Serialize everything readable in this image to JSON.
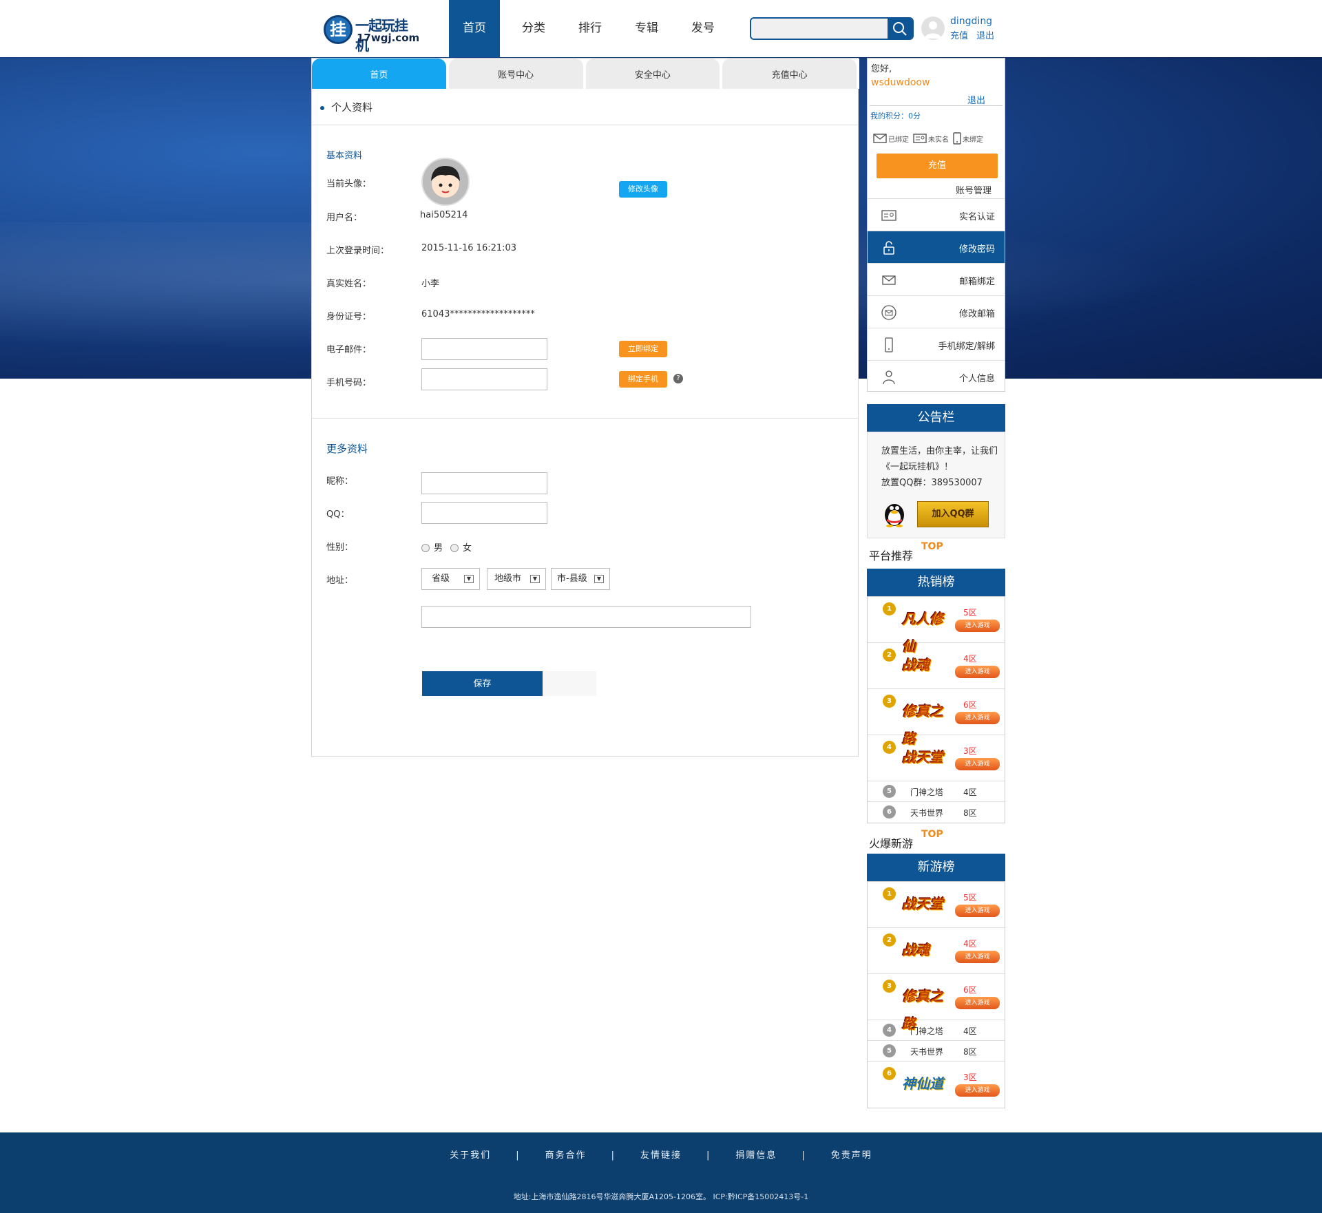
{
  "header": {
    "logo_text": "一起玩挂机",
    "logo_url": "17wgj.com",
    "nav": [
      "首页",
      "分类",
      "排行",
      "专辑",
      "发号"
    ],
    "search_placeholder": "",
    "user_name": "dingding",
    "user_links": [
      "充值",
      "退出"
    ]
  },
  "tabs": [
    "首页",
    "账号中心",
    "安全中心",
    "充值中心"
  ],
  "profile": {
    "section_title": "个人资料",
    "basic_title": "基本资料",
    "avatar_label": "当前头像：",
    "avatar_button": "修改头像",
    "username_label": "用户名：",
    "username": "hai505214",
    "last_login_label": "上次登录时间：",
    "last_login": "2015-11-16 16:21:03",
    "real_name_label": "真实姓名：",
    "real_name": "小李",
    "id_label": "身份证号：",
    "id_number": "61043*******************",
    "email_label": "电子邮件：",
    "email_value": "",
    "email_button": "立即绑定",
    "phone_label": "手机号码：",
    "phone_value": "",
    "phone_button": "绑定手机",
    "help": "?",
    "more_title": "更多资料",
    "nickname_label": "昵称：",
    "qq_label": "QQ：",
    "gender_label": "性别：",
    "gender_options": [
      "男",
      "女"
    ],
    "address_label": "地址：",
    "address_selects": [
      "省级",
      "地级市",
      "市-县级"
    ],
    "save_button": "保存"
  },
  "sidebar": {
    "hello": "您好,",
    "username": "wsduwdoow",
    "logout": "退出",
    "points": "我的积分：0分",
    "binds": [
      "已绑定",
      "未实名",
      "未绑定"
    ],
    "recharge": "充值",
    "account_manage": "账号管理",
    "menu": [
      {
        "label": "实名认证",
        "icon": "id-card-icon"
      },
      {
        "label": "修改密码",
        "icon": "lock-icon"
      },
      {
        "label": "邮箱绑定",
        "icon": "mail-icon"
      },
      {
        "label": "修改邮箱",
        "icon": "mail-circle-icon"
      },
      {
        "label": "手机绑定/解绑",
        "icon": "phone-icon"
      },
      {
        "label": "个人信息",
        "icon": "person-icon"
      }
    ],
    "notice_title": "公告栏",
    "notice_text_1": "放置生活，由你主宰，让我们《一起玩挂机》！",
    "notice_text_2": "放置QQ群：389530007",
    "qq_button": "加入QQ群",
    "platform_title": "平台推荐",
    "top_mark": "TOP",
    "hot_title": "热销榜",
    "hot_list": [
      {
        "rank": "1",
        "logo": "凡人修仙",
        "zone": "5区",
        "button": "进入游戏"
      },
      {
        "rank": "2",
        "logo": "战魂",
        "zone": "4区",
        "button": "进入游戏"
      },
      {
        "rank": "3",
        "logo": "修真之路",
        "zone": "6区",
        "button": "进入游戏"
      },
      {
        "rank": "4",
        "logo": "战天堂",
        "zone": "3区",
        "button": "进入游戏"
      }
    ],
    "hot_small": [
      {
        "rank": "5",
        "name": "门神之塔",
        "zone": "4区"
      },
      {
        "rank": "6",
        "name": "天书世界",
        "zone": "8区"
      }
    ],
    "new_title_section": "火爆新游",
    "new_title": "新游榜",
    "new_list": [
      {
        "rank": "1",
        "logo": "战天堂",
        "zone": "5区",
        "button": "进入游戏"
      },
      {
        "rank": "2",
        "logo": "战魂",
        "zone": "4区",
        "button": "进入游戏"
      },
      {
        "rank": "3",
        "logo": "修真之路",
        "zone": "6区",
        "button": "进入游戏"
      }
    ],
    "new_small": [
      {
        "rank": "4",
        "name": "门神之塔",
        "zone": "4区"
      },
      {
        "rank": "5",
        "name": "天书世界",
        "zone": "8区"
      }
    ],
    "new_last": {
      "rank": "6",
      "logo": "神仙道",
      "zone": "3区",
      "button": "进入游戏"
    }
  },
  "footer": {
    "links": [
      "关于我们",
      "商务合作",
      "友情链接",
      "捐赠信息",
      "免责声明"
    ],
    "address": "地址:上海市逸仙路2816号华滋奔腾大厦A1205-1206室。  ICP:黔ICP备15002413号-1"
  },
  "colors": {
    "primary": "#0d5594",
    "accent": "#f7931e",
    "tab_active": "#14a6f0",
    "footer": "#0d3f6e"
  }
}
